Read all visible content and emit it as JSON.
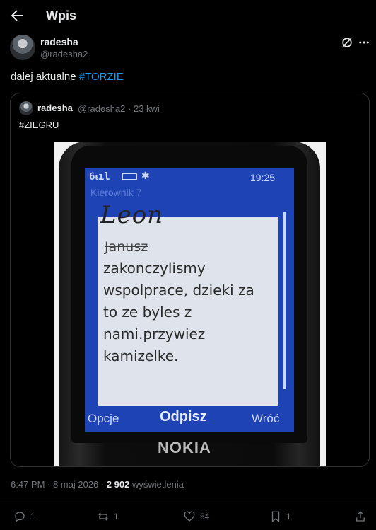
{
  "header": {
    "back_icon": "arrow-left-icon",
    "title": "Wpis"
  },
  "post": {
    "author_name": "radesha",
    "author_handle": "@radesha2",
    "text_prefix": "dalej aktualne ",
    "hashtag": "#TORZIE",
    "timestamp": "6:47 PM · 8 maj 2026 · ",
    "views_count": "2 902",
    "views_label": " wyświetlenia"
  },
  "quoted": {
    "author_name": "radesha",
    "author_handle": "@radesha2",
    "date": "· 23 kwi",
    "text": "#ZIEGRU"
  },
  "phone_screen": {
    "signal": "6ᵼıl",
    "time": "19:25",
    "sender": "Kierownik 7",
    "handwritten_name": "Leon",
    "crossed_name": "Janusz",
    "message": "zakonczylismy wspolprace, dzieki za to ze byles z nami.przywiez kamizelke.",
    "soft_left": "Opcje",
    "soft_middle": "Odpisz",
    "soft_right": "Wróć",
    "brand": "NOKIA"
  },
  "actions": {
    "replies": "1",
    "reposts": "1",
    "likes": "64",
    "bookmarks": "1"
  },
  "colors": {
    "background": "#000000",
    "text": "#e7e9ea",
    "secondary": "#71767b",
    "accent": "#1d9bf0",
    "border": "#2f3336"
  }
}
